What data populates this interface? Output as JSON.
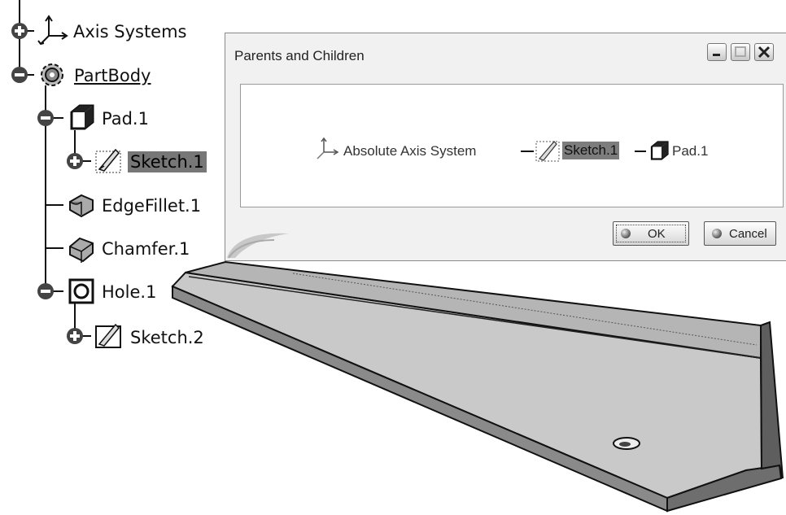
{
  "tree": {
    "items": [
      {
        "label": "Axis Systems",
        "icon": "axis-icon",
        "expander": "plus"
      },
      {
        "label": "PartBody",
        "icon": "gear-icon",
        "expander": "minus"
      },
      {
        "label": "Pad.1",
        "icon": "pad-icon",
        "expander": "minus"
      },
      {
        "label": "Sketch.1",
        "icon": "sketch-icon",
        "expander": "plus",
        "selected": true
      },
      {
        "label": "EdgeFillet.1",
        "icon": "edgefillet-icon"
      },
      {
        "label": "Chamfer.1",
        "icon": "chamfer-icon"
      },
      {
        "label": "Hole.1",
        "icon": "hole-icon",
        "expander": "minus"
      },
      {
        "label": "Sketch.2",
        "icon": "sketch-icon",
        "expander": "plus"
      }
    ]
  },
  "dialog": {
    "title": "Parents and Children",
    "graph": {
      "parent": "Absolute Axis System",
      "selected": "Sketch.1",
      "child": "Pad.1"
    },
    "ok_label": "OK",
    "cancel_label": "Cancel"
  },
  "colors": {
    "selection": "#777777",
    "dialog_bg": "#f1f1f1",
    "part_fill": "#bdbdbd"
  }
}
